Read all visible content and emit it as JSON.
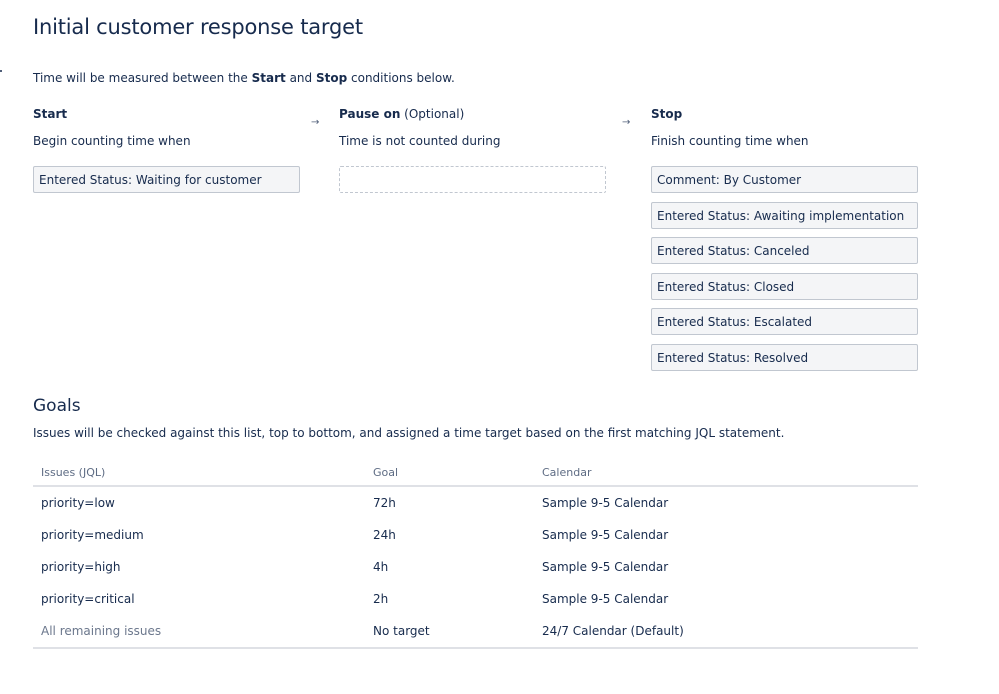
{
  "header": {
    "title": "Initial customer response target"
  },
  "intro": {
    "before": "Time will be measured between the ",
    "start": "Start",
    "and": " and ",
    "stop": "Stop",
    "after": " conditions below."
  },
  "conditions": {
    "arrow": "→",
    "start": {
      "heading": "Start",
      "subtitle": "Begin counting time when",
      "items": [
        "Entered Status: Waiting for customer"
      ]
    },
    "pause": {
      "heading": "Pause on",
      "optional": " (Optional)",
      "subtitle": "Time is not counted during",
      "items": []
    },
    "stop": {
      "heading": "Stop",
      "subtitle": "Finish counting time when",
      "items": [
        "Comment: By Customer",
        "Entered Status: Awaiting implementation",
        "Entered Status: Canceled",
        "Entered Status: Closed",
        "Entered Status: Escalated",
        "Entered Status: Resolved"
      ]
    }
  },
  "goals": {
    "title": "Goals",
    "description": "Issues will be checked against this list, top to bottom, and assigned a time target based on the first matching JQL statement.",
    "columns": [
      "Issues (JQL)",
      "Goal",
      "Calendar"
    ],
    "rows": [
      {
        "jql": "priority=low",
        "goal": "72h",
        "calendar": "Sample 9-5 Calendar"
      },
      {
        "jql": "priority=medium",
        "goal": "24h",
        "calendar": "Sample 9-5 Calendar"
      },
      {
        "jql": "priority=high",
        "goal": "4h",
        "calendar": "Sample 9-5 Calendar"
      },
      {
        "jql": "priority=critical",
        "goal": "2h",
        "calendar": "Sample 9-5 Calendar"
      }
    ],
    "remaining": {
      "jql": "All remaining issues",
      "goal": "No target",
      "calendar": "24/7 Calendar (Default)"
    }
  }
}
